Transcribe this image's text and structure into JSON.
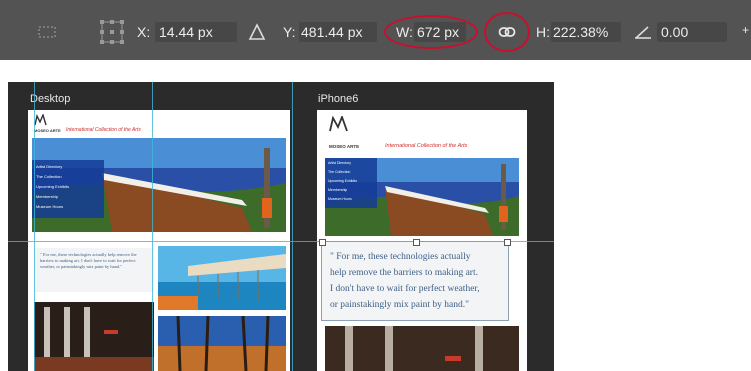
{
  "options_bar": {
    "x_label": "X:",
    "x_value": "14.44 px",
    "y_label": "Y:",
    "y_value": "481.44 px",
    "w_label": "W:",
    "w_value": "672 px",
    "h_label": "H:",
    "h_value": "222.38%",
    "angle_value": "0.00",
    "icons": [
      "align-icon",
      "transform-reference-icon",
      "delta-icon",
      "link-icon",
      "angle-icon",
      "plus-icon"
    ]
  },
  "canvas": {
    "artboard_desktop_label": "Desktop",
    "artboard_phone_label": "iPhone6",
    "logo_text": "MOSEO ARTE",
    "collection_title": "International Collection of the Arts",
    "quote": "\" For me, these technologies actually help remove the barriers to making art. I don't have to wait for perfect weather, or painstakingly mix paint by hand.\"",
    "quote_lines": [
      "\" For me, these technologies actually",
      "help remove the barriers to making art.",
      "I don't have to wait for perfect weather,",
      "or painstakingly mix paint by hand.\""
    ],
    "nav_items": [
      "Artist Directory",
      "The Collection",
      "Upcoming Exhibits",
      "Membership",
      "Museum Hours"
    ],
    "colors": {
      "highlight_ring": "#c8102e",
      "guide": "#3fb6d8",
      "title_red": "#d0312d"
    }
  }
}
